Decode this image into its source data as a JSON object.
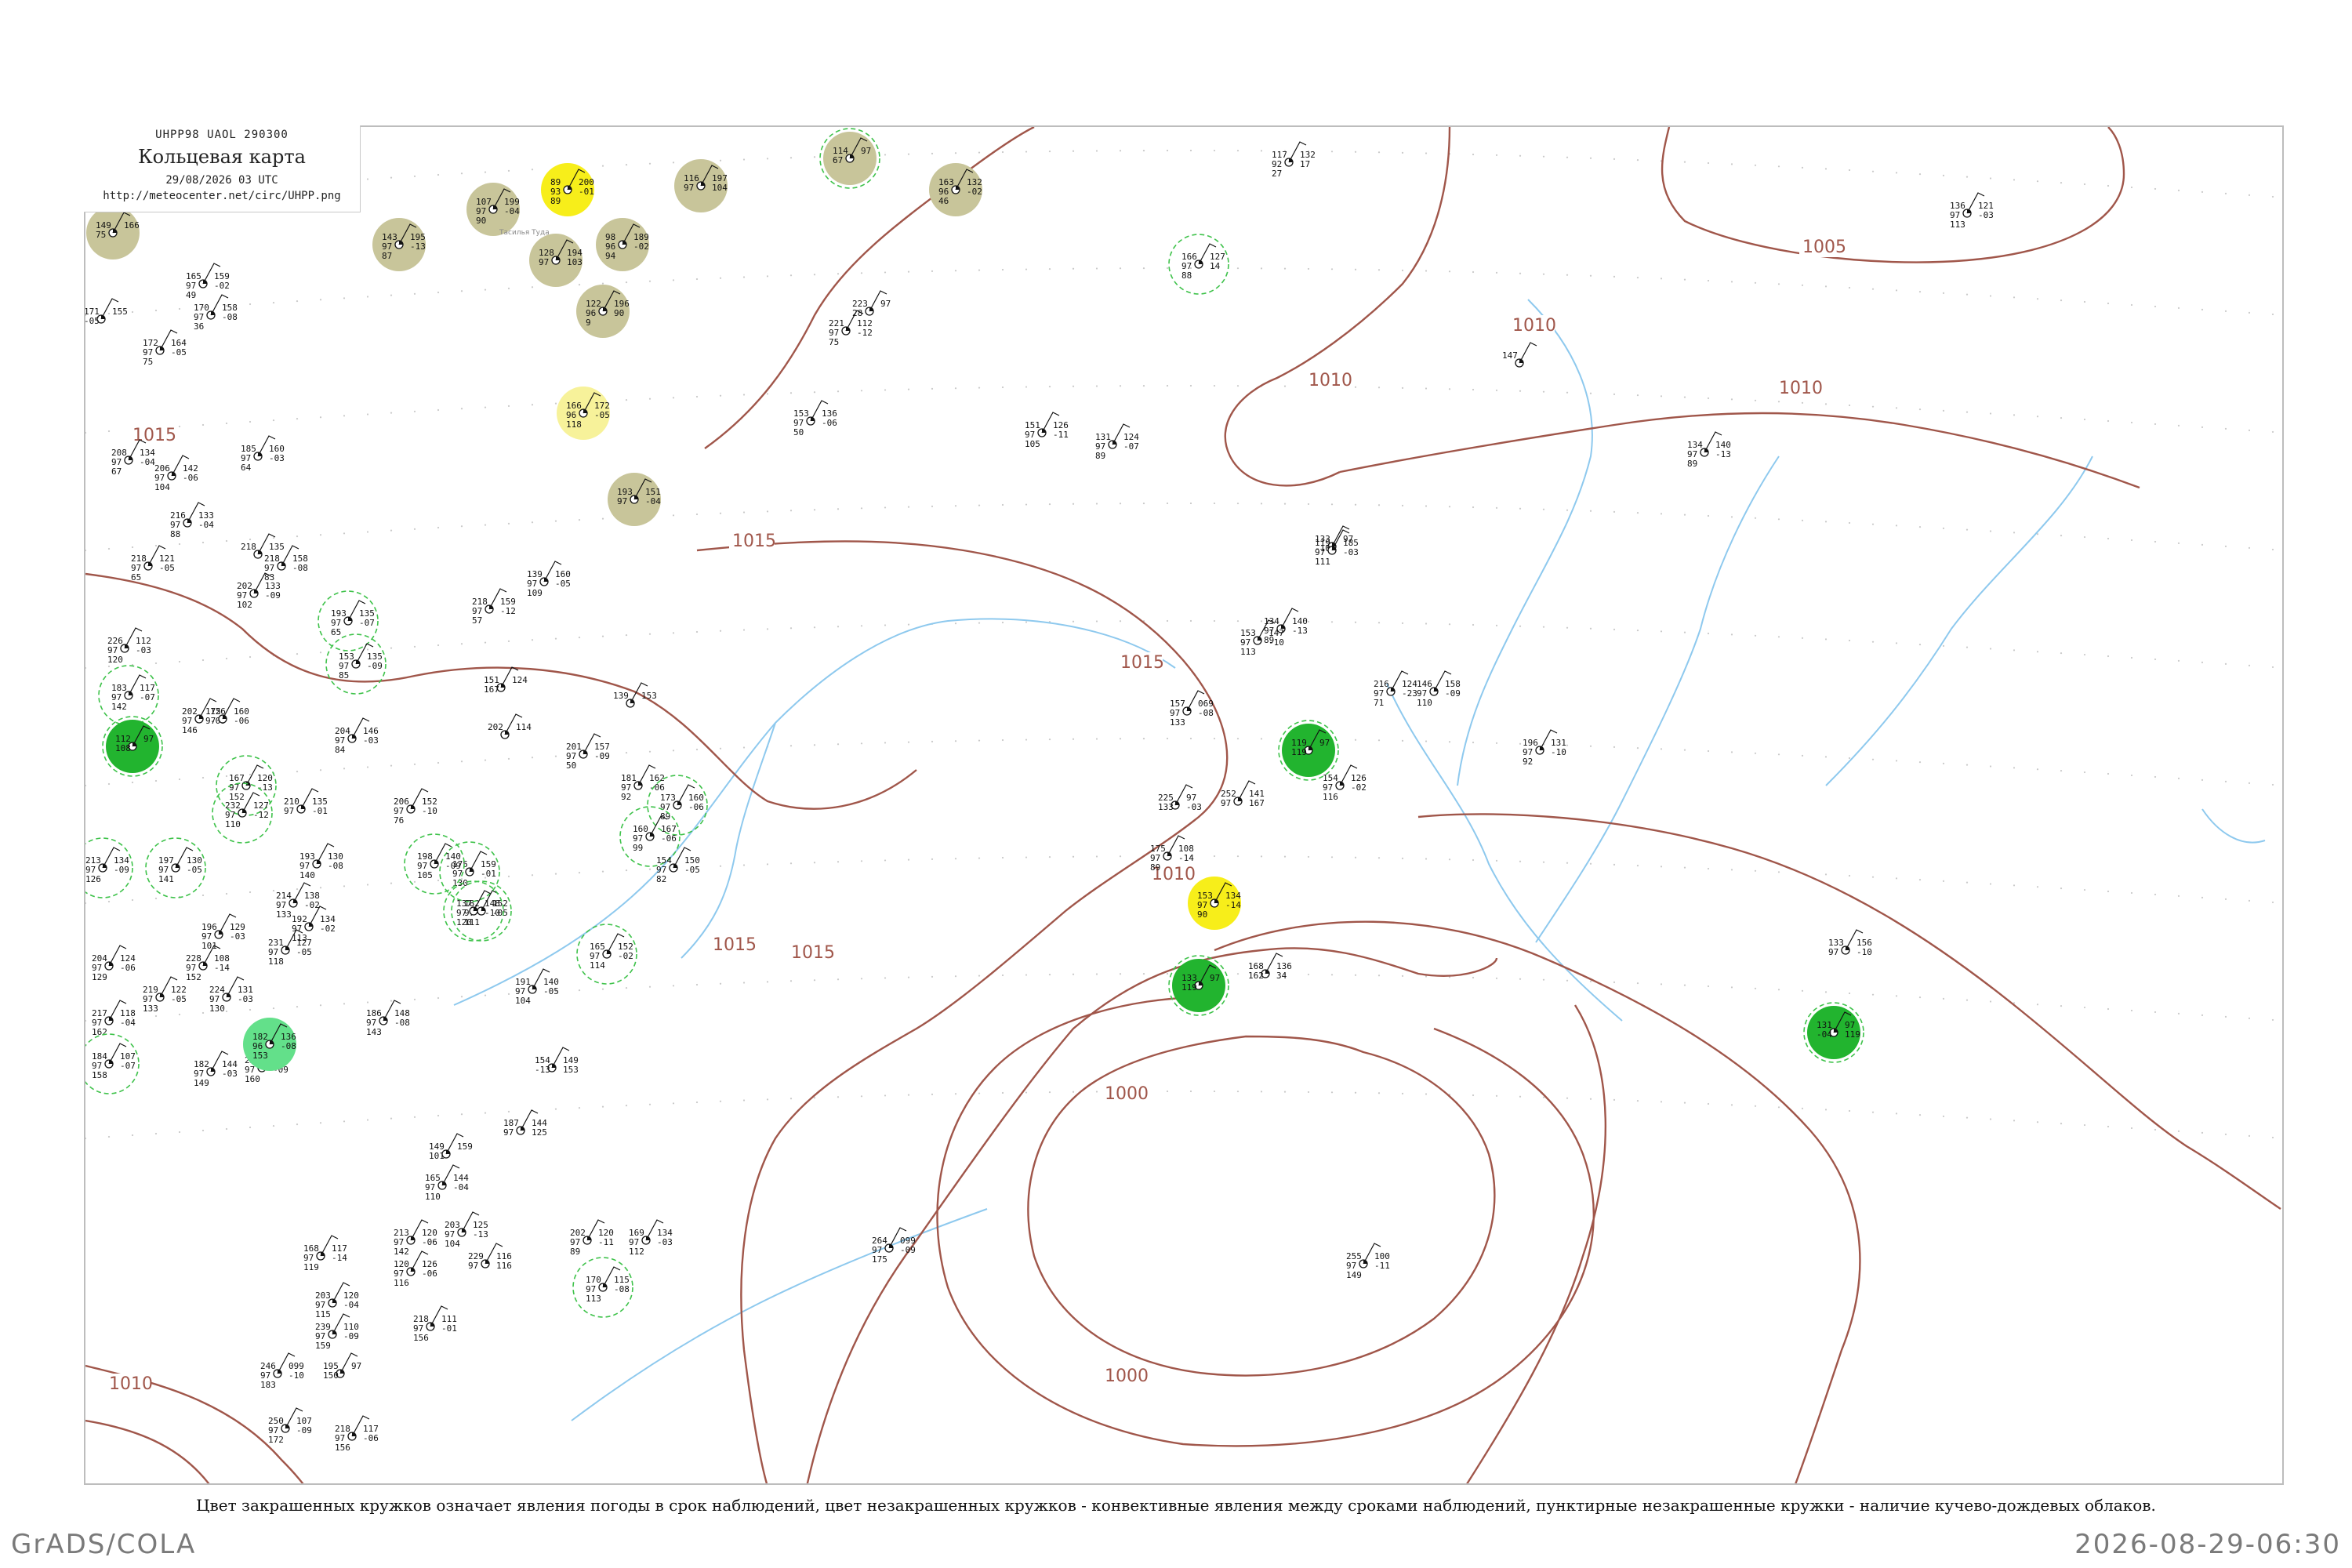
{
  "header": {
    "code_line": "UHPP98  UAOL  290300",
    "title": "Кольцевая карта",
    "datetime": "29/08/2026 03 UTC",
    "url": "http://meteocenter.net/circ/UHPP.png"
  },
  "caption": "Цвет закрашенных кружков означает явления погоды в срок наблюдений, цвет незакрашенных кружков - конвективные явления между сроками наблюдений, пунктирные незакрашенные кружки - наличие кучево-дождевых облаков.",
  "footer": {
    "left": "GrADS/COLA",
    "right": "2026-08-29-06:30"
  },
  "colors": {
    "isobar": "#a0564a",
    "river": "#8ec9ee",
    "fog_fill": "#c8c59a",
    "light_fog_fill": "#f7f29a",
    "bright_fill": "#f7ee1a",
    "rain_fill": "#22b42f",
    "shower_fill": "#63e08a",
    "cb_dash": "#3ec24a"
  },
  "isobar_labels": [
    {
      "text": "1015",
      "kind": "upper-left"
    },
    {
      "text": "1015",
      "kind": "center-top"
    },
    {
      "text": "1015",
      "kind": "center"
    },
    {
      "text": "1015",
      "kind": "river"
    },
    {
      "text": "1010",
      "kind": "center-low"
    },
    {
      "text": "1010",
      "kind": "east"
    },
    {
      "text": "1010",
      "kind": "north"
    },
    {
      "text": "1010",
      "kind": "northeast"
    },
    {
      "text": "1005",
      "kind": "far-northeast"
    },
    {
      "text": "1000",
      "kind": "low-center-top"
    },
    {
      "text": "1000",
      "kind": "low-center-bottom"
    },
    {
      "text": "1010",
      "kind": "sw-edge"
    },
    {
      "text": "1015",
      "kind": "sw-edge"
    }
  ],
  "stations": [
    {
      "values": [
        "149",
        "166",
        "75"
      ],
      "name": "",
      "fill": "fog"
    },
    {
      "values": [
        "107",
        "199",
        "97",
        "-04",
        "90"
      ],
      "name": "Тасилья Туда",
      "fill": "fog"
    },
    {
      "values": [
        "89",
        "200",
        "93",
        "-01",
        "89"
      ],
      "name": "",
      "fill": "bright"
    },
    {
      "values": [
        "116",
        "197",
        "97",
        "104"
      ],
      "name": "",
      "fill": "fog"
    },
    {
      "values": [
        "114",
        "97",
        "67"
      ],
      "name": "",
      "fill": "fog-cb"
    },
    {
      "values": [
        "163",
        "132",
        "96",
        "-02",
        "46"
      ],
      "name": "",
      "fill": "fog"
    },
    {
      "values": [
        "143",
        "195",
        "97",
        "-13",
        "87"
      ],
      "name": "",
      "fill": "fog"
    },
    {
      "values": [
        "128",
        "194",
        "97",
        "103"
      ],
      "name": "",
      "fill": "fog"
    },
    {
      "values": [
        "98",
        "189",
        "96",
        "-02",
        "94"
      ],
      "name": "",
      "fill": "fog"
    },
    {
      "values": [
        "122",
        "196",
        "96",
        "90",
        "9"
      ],
      "name": "",
      "fill": "fog"
    },
    {
      "values": [
        "166",
        "172",
        "96",
        "-05",
        "118"
      ],
      "name": "",
      "fill": "light-fog"
    },
    {
      "values": [
        "193",
        "151",
        "97",
        "-04"
      ],
      "name": "",
      "fill": "fog"
    },
    {
      "values": [
        "117",
        "132",
        "92",
        "17",
        "27"
      ],
      "name": "",
      "fill": "none"
    },
    {
      "values": [
        "166",
        "127",
        "97",
        "14",
        "88"
      ],
      "name": "",
      "fill": "cb"
    },
    {
      "values": [
        "221",
        "112",
        "97",
        "-12",
        "75"
      ],
      "name": "",
      "fill": "none"
    },
    {
      "values": [
        "223",
        "97",
        "28"
      ],
      "name": "",
      "fill": "none"
    },
    {
      "values": [
        "153",
        "136",
        "97",
        "-06",
        "50"
      ],
      "name": "",
      "fill": "none"
    },
    {
      "values": [
        "151",
        "126",
        "97",
        "-11",
        "105"
      ],
      "name": "",
      "fill": "none"
    },
    {
      "values": [
        "131",
        "124",
        "97",
        "-07",
        "89"
      ],
      "name": "",
      "fill": "none"
    },
    {
      "values": [
        "165",
        "159",
        "97",
        "-02",
        "49"
      ],
      "name": "",
      "fill": "none"
    },
    {
      "values": [
        "170",
        "158",
        "97",
        "-08",
        "36"
      ],
      "name": "",
      "fill": "none"
    },
    {
      "values": [
        "171",
        "155",
        "-05"
      ],
      "name": "",
      "fill": "none"
    },
    {
      "values": [
        "172",
        "164",
        "97",
        "-05",
        "75"
      ],
      "name": "",
      "fill": "none"
    },
    {
      "values": [
        "208",
        "134",
        "97",
        "-04",
        "67"
      ],
      "name": "",
      "fill": "none"
    },
    {
      "values": [
        "185",
        "160",
        "97",
        "-03",
        "64"
      ],
      "name": "",
      "fill": "none"
    },
    {
      "values": [
        "206",
        "142",
        "97",
        "-06",
        "104"
      ],
      "name": "",
      "fill": "none"
    },
    {
      "values": [
        "216",
        "133",
        "97",
        "-04",
        "88"
      ],
      "name": "",
      "fill": "none"
    },
    {
      "values": [
        "218",
        "121",
        "97",
        "-05",
        "65"
      ],
      "name": "",
      "fill": "none"
    },
    {
      "values": [
        "218",
        "135"
      ],
      "name": "",
      "fill": "none"
    },
    {
      "values": [
        "202",
        "133",
        "97",
        "-09",
        "102"
      ],
      "name": "",
      "fill": "none"
    },
    {
      "values": [
        "218",
        "159",
        "97",
        "-12",
        "57"
      ],
      "name": "",
      "fill": "none"
    },
    {
      "values": [
        "139",
        "160",
        "97",
        "-05",
        "109"
      ],
      "name": "",
      "fill": "none"
    },
    {
      "values": [
        "134",
        "140",
        "97",
        "-13",
        "89"
      ],
      "name": "",
      "fill": "none"
    },
    {
      "values": [
        "133",
        "97",
        "-10"
      ],
      "name": "",
      "fill": "none"
    },
    {
      "values": [
        "193",
        "135",
        "97",
        "-07",
        "65"
      ],
      "name": "",
      "fill": "cb"
    },
    {
      "values": [
        "153",
        "135",
        "97",
        "-09",
        "85"
      ],
      "name": "",
      "fill": "cb"
    },
    {
      "values": [
        "226",
        "112",
        "97",
        "-03",
        "120"
      ],
      "name": "",
      "fill": "none"
    },
    {
      "values": [
        "183",
        "117",
        "97",
        "-07",
        "142"
      ],
      "name": "",
      "fill": "cb"
    },
    {
      "values": [
        "112",
        "97",
        "108"
      ],
      "name": "",
      "fill": "rain-cb"
    },
    {
      "values": [
        "202",
        "126",
        "97",
        "-09",
        "146"
      ],
      "name": "",
      "fill": "none"
    },
    {
      "values": [
        "175",
        "160",
        "97",
        "-06"
      ],
      "name": "",
      "fill": "none"
    },
    {
      "values": [
        "204",
        "146",
        "97",
        "-03",
        "84"
      ],
      "name": "",
      "fill": "none"
    },
    {
      "values": [
        "210",
        "135",
        "97",
        "-01"
      ],
      "name": "",
      "fill": "none"
    },
    {
      "values": [
        "167",
        "120",
        "97",
        "-13",
        "152"
      ],
      "name": "",
      "fill": "cb"
    },
    {
      "values": [
        "232",
        "127",
        "97",
        "-12",
        "110"
      ],
      "name": "",
      "fill": "cb"
    },
    {
      "values": [
        "213",
        "134",
        "97",
        "-09",
        "126"
      ],
      "name": "",
      "fill": "cb"
    },
    {
      "values": [
        "197",
        "130",
        "97",
        "-05",
        "141"
      ],
      "name": "",
      "fill": "cb"
    },
    {
      "values": [
        "193",
        "130",
        "97",
        "-08",
        "140"
      ],
      "name": "",
      "fill": "none"
    },
    {
      "values": [
        "214",
        "138",
        "97",
        "-02",
        "133"
      ],
      "name": "",
      "fill": "none"
    },
    {
      "values": [
        "192",
        "134",
        "97",
        "-02",
        "113"
      ],
      "name": "",
      "fill": "none"
    },
    {
      "values": [
        "196",
        "129",
        "97",
        "-03",
        "101"
      ],
      "name": "",
      "fill": "none"
    },
    {
      "values": [
        "231",
        "127",
        "97",
        "-05",
        "118"
      ],
      "name": "",
      "fill": "none"
    },
    {
      "values": [
        "204",
        "124",
        "97",
        "-06",
        "129"
      ],
      "name": "",
      "fill": "none"
    },
    {
      "values": [
        "228",
        "108",
        "97",
        "-14",
        "152"
      ],
      "name": "",
      "fill": "none"
    },
    {
      "values": [
        "224",
        "131",
        "97",
        "-03",
        "130"
      ],
      "name": "",
      "fill": "none"
    },
    {
      "values": [
        "219",
        "122",
        "97",
        "-05",
        "133"
      ],
      "name": "",
      "fill": "none"
    },
    {
      "values": [
        "217",
        "118",
        "97",
        "-04",
        "162"
      ],
      "name": "",
      "fill": "none"
    },
    {
      "values": [
        "184",
        "107",
        "97",
        "-07",
        "158"
      ],
      "name": "",
      "fill": "cb"
    },
    {
      "values": [
        "225",
        "108",
        "97",
        "-09",
        "160"
      ],
      "name": "",
      "fill": "none"
    },
    {
      "values": [
        "182",
        "144",
        "97",
        "-03",
        "149"
      ],
      "name": "",
      "fill": "none"
    },
    {
      "values": [
        "182",
        "136",
        "96",
        "-08",
        "153"
      ],
      "name": "",
      "fill": "shower"
    },
    {
      "values": [
        "186",
        "148",
        "97",
        "-08",
        "143"
      ],
      "name": "",
      "fill": "none"
    },
    {
      "values": [
        "154",
        "149",
        "-13",
        "153"
      ],
      "name": "",
      "fill": "none"
    },
    {
      "values": [
        "191",
        "140",
        "97",
        "-05",
        "104"
      ],
      "name": "",
      "fill": "none"
    },
    {
      "values": [
        "165",
        "152",
        "97",
        "-02",
        "114"
      ],
      "name": "",
      "fill": "cb"
    },
    {
      "values": [
        "182",
        "152",
        "97",
        "-05",
        "111"
      ],
      "name": "",
      "fill": "cb"
    },
    {
      "values": [
        "175",
        "159",
        "97",
        "-01",
        "130"
      ],
      "name": "",
      "fill": "cb"
    },
    {
      "values": [
        "137",
        "148",
        "97",
        "-10",
        "120"
      ],
      "name": "",
      "fill": "cb"
    },
    {
      "values": [
        "198",
        "140",
        "97",
        "-09",
        "105"
      ],
      "name": "",
      "fill": "cb"
    },
    {
      "values": [
        "206",
        "152",
        "97",
        "-10",
        "76"
      ],
      "name": "",
      "fill": "none"
    },
    {
      "values": [
        "218",
        "158",
        "97",
        "-08",
        "83"
      ],
      "name": "",
      "fill": "none"
    },
    {
      "values": [
        "151",
        "124",
        "167"
      ],
      "name": "",
      "fill": "none"
    },
    {
      "values": [
        "202",
        "114"
      ],
      "name": "",
      "fill": "none"
    },
    {
      "values": [
        "139",
        "153"
      ],
      "name": "",
      "fill": "none"
    },
    {
      "values": [
        "201",
        "157",
        "97",
        "-09",
        "50"
      ],
      "name": "",
      "fill": "none"
    },
    {
      "values": [
        "181",
        "162",
        "97",
        "-06",
        "92"
      ],
      "name": "",
      "fill": "none"
    },
    {
      "values": [
        "173",
        "160",
        "97",
        "-06",
        "89"
      ],
      "name": "",
      "fill": "cb"
    },
    {
      "values": [
        "160",
        "167",
        "97",
        "-06",
        "99"
      ],
      "name": "",
      "fill": "cb"
    },
    {
      "values": [
        "154",
        "150",
        "97",
        "-05",
        "82"
      ],
      "name": "",
      "fill": "none"
    },
    {
      "values": [
        "149",
        "159",
        "101"
      ],
      "name": "",
      "fill": "none"
    },
    {
      "values": [
        "187",
        "144",
        "97",
        "125"
      ],
      "name": "",
      "fill": "none"
    },
    {
      "values": [
        "165",
        "144",
        "97",
        "-04",
        "110"
      ],
      "name": "",
      "fill": "none"
    },
    {
      "values": [
        "203",
        "125",
        "97",
        "-13",
        "104"
      ],
      "name": "",
      "fill": "none"
    },
    {
      "values": [
        "202",
        "120",
        "97",
        "-11",
        "89"
      ],
      "name": "",
      "fill": "none"
    },
    {
      "values": [
        "169",
        "134",
        "97",
        "-03",
        "112"
      ],
      "name": "",
      "fill": "none"
    },
    {
      "values": [
        "170",
        "115",
        "97",
        "-08",
        "113"
      ],
      "name": "",
      "fill": "cb"
    },
    {
      "values": [
        "168",
        "117",
        "97",
        "-14",
        "119"
      ],
      "name": "",
      "fill": "none"
    },
    {
      "values": [
        "213",
        "120",
        "97",
        "-06",
        "142"
      ],
      "name": "",
      "fill": "none"
    },
    {
      "values": [
        "120",
        "126",
        "97",
        "-06",
        "116"
      ],
      "name": "",
      "fill": "none"
    },
    {
      "values": [
        "229",
        "116",
        "97",
        "116"
      ],
      "name": "",
      "fill": "none"
    },
    {
      "values": [
        "203",
        "120",
        "97",
        "-04",
        "115"
      ],
      "name": "",
      "fill": "none"
    },
    {
      "values": [
        "239",
        "110",
        "97",
        "-09",
        "159"
      ],
      "name": "",
      "fill": "none"
    },
    {
      "values": [
        "218",
        "111",
        "97",
        "-01",
        "156"
      ],
      "name": "",
      "fill": "none"
    },
    {
      "values": [
        "195",
        "97",
        "150"
      ],
      "name": "",
      "fill": "none"
    },
    {
      "values": [
        "246",
        "099",
        "97",
        "-10",
        "183"
      ],
      "name": "",
      "fill": "none"
    },
    {
      "values": [
        "250",
        "107",
        "97",
        "-09",
        "172"
      ],
      "name": "",
      "fill": "none"
    },
    {
      "values": [
        "218",
        "117",
        "97",
        "-06",
        "156"
      ],
      "name": "",
      "fill": "none"
    },
    {
      "values": [
        "264",
        "099",
        "97",
        "-09",
        "175"
      ],
      "name": "",
      "fill": "none"
    },
    {
      "values": [
        "255",
        "100",
        "97",
        "-11",
        "149"
      ],
      "name": "",
      "fill": "none"
    },
    {
      "values": [
        "225",
        "97",
        "133",
        "-03"
      ],
      "name": "",
      "fill": "none"
    },
    {
      "values": [
        "252",
        "141",
        "97",
        "167"
      ],
      "name": "",
      "fill": "none"
    },
    {
      "values": [
        "175",
        "108",
        "97",
        "-14",
        "89"
      ],
      "name": "",
      "fill": "none"
    },
    {
      "values": [
        "153",
        "134",
        "97",
        "-14",
        "90"
      ],
      "name": "",
      "fill": "bright"
    },
    {
      "values": [
        "157",
        "069",
        "97",
        "-08",
        "133"
      ],
      "name": "",
      "fill": "none"
    },
    {
      "values": [
        "119",
        "97",
        "119"
      ],
      "name": "",
      "fill": "rain-cb"
    },
    {
      "values": [
        "154",
        "126",
        "97",
        "-02",
        "116"
      ],
      "name": "",
      "fill": "none"
    },
    {
      "values": [
        "216",
        "124",
        "97",
        "-23",
        "71"
      ],
      "name": "",
      "fill": "none"
    },
    {
      "values": [
        "146",
        "158",
        "97",
        "-09",
        "110"
      ],
      "name": "",
      "fill": "none"
    },
    {
      "values": [
        "196",
        "131",
        "97",
        "-10",
        "92"
      ],
      "name": "",
      "fill": "none"
    },
    {
      "values": [
        "153",
        "147",
        "97",
        "-10",
        "113"
      ],
      "name": "",
      "fill": "none"
    },
    {
      "values": [
        "119",
        "185",
        "97",
        "-03",
        "111"
      ],
      "name": "",
      "fill": "none"
    },
    {
      "values": [
        "134",
        "140",
        "97",
        "-13",
        "89"
      ],
      "name": "",
      "fill": "none"
    },
    {
      "values": [
        "133",
        "156",
        "97",
        "-10"
      ],
      "name": "",
      "fill": "none"
    },
    {
      "values": [
        "136",
        "121",
        "97",
        "-03",
        "113"
      ],
      "name": "",
      "fill": "none"
    },
    {
      "values": [
        "168",
        "136",
        "162",
        "34"
      ],
      "name": "",
      "fill": "none"
    },
    {
      "values": [
        "133",
        "97",
        "119"
      ],
      "name": "",
      "fill": "rain-cb"
    },
    {
      "values": [
        "131",
        "97",
        "-04",
        "119"
      ],
      "name": "",
      "fill": "rain-cb"
    },
    {
      "values": [
        "147"
      ],
      "name": "",
      "fill": "none"
    }
  ]
}
